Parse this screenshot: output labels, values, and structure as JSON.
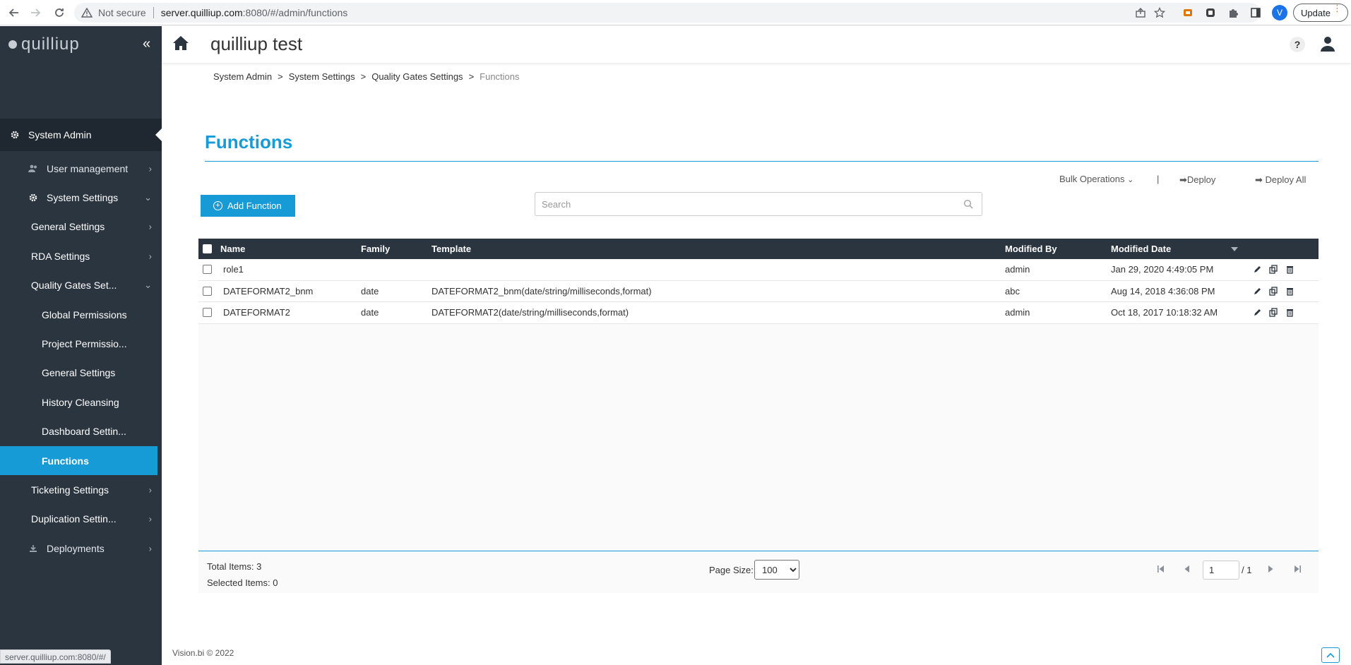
{
  "browser": {
    "not_secure": "Not secure",
    "url_host": "server.quilliup.com",
    "url_path": ":8080/#/admin/functions",
    "profile_initial": "V",
    "update_label": "Update",
    "status_url": "server.quilliup.com:8080/#/"
  },
  "app": {
    "logo_text": "quilliup",
    "title": "quilliup test",
    "help_label": "?"
  },
  "sidebar": {
    "items": [
      {
        "label": "System Admin"
      },
      {
        "label": "User management"
      },
      {
        "label": "System Settings"
      },
      {
        "label": "General Settings"
      },
      {
        "label": "RDA Settings"
      },
      {
        "label": "Quality Gates Set..."
      },
      {
        "label": "Global Permissions"
      },
      {
        "label": "Project Permissio..."
      },
      {
        "label": "General Settings"
      },
      {
        "label": "History Cleansing"
      },
      {
        "label": "Dashboard Settin..."
      },
      {
        "label": "Functions"
      },
      {
        "label": "Ticketing Settings"
      },
      {
        "label": "Duplication Settin..."
      },
      {
        "label": "Deployments"
      }
    ]
  },
  "breadcrumb": {
    "items": [
      "System Admin",
      "System Settings",
      "Quality Gates Settings",
      "Functions"
    ],
    "separator": ">"
  },
  "page": {
    "title": "Functions",
    "bulk_operations": "Bulk Operations",
    "bulk_separator": "|",
    "deploy": "Deploy",
    "deploy_all": "Deploy All",
    "add_function": "Add Function",
    "search_placeholder": "Search"
  },
  "table": {
    "columns": [
      "Name",
      "Family",
      "Template",
      "Modified By",
      "Modified Date"
    ],
    "rows": [
      {
        "name": "role1",
        "family": "",
        "template": "",
        "modified_by": "admin",
        "modified_date": "Jan 29, 2020 4:49:05 PM"
      },
      {
        "name": "DATEFORMAT2_bnm",
        "family": "date",
        "template": "DATEFORMAT2_bnm(date/string/milliseconds,format)",
        "modified_by": "abc",
        "modified_date": "Aug 14, 2018 4:36:08 PM"
      },
      {
        "name": "DATEFORMAT2",
        "family": "date",
        "template": "DATEFORMAT2(date/string/milliseconds,format)",
        "modified_by": "admin",
        "modified_date": "Oct 18, 2017 10:18:32 AM"
      }
    ]
  },
  "pagination": {
    "total_items": "Total Items: 3",
    "selected_items": "Selected Items: 0",
    "page_size_label": "Page Size:",
    "page_size": "100",
    "current_page": "1",
    "total_pages": "/ 1"
  },
  "footer": {
    "copyright": "Vision.bi © 2022"
  },
  "colors": {
    "accent": "#179bd7",
    "sidebar_bg": "#2b3540",
    "table_header_bg": "#2b3540"
  }
}
